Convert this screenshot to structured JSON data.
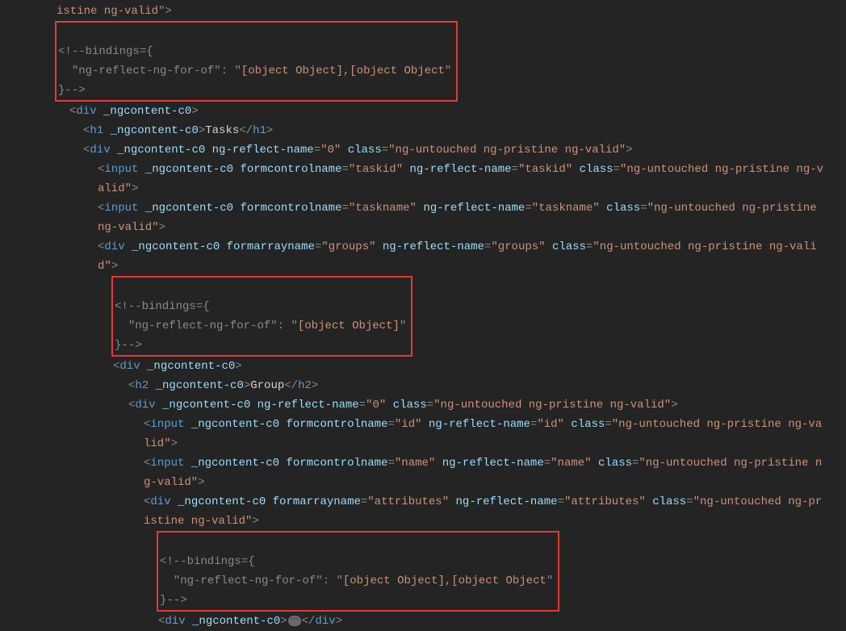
{
  "line0": {
    "text1": "istine ng-valid",
    "close": "\">"
  },
  "box1": {
    "l1": "<!--bindings={",
    "l2a": "  \"ng-reflect-ng-for-of\": \"",
    "l2b": "[object Object],[object Object",
    "l2c": "\"",
    "l3": "}-->"
  },
  "divTasks": {
    "open": "<",
    "tag": "div",
    "attr1": "_ngcontent-c0",
    "close": ">",
    "h1": {
      "open": "<",
      "tag": "h1",
      "attr": "_ngcontent-c0",
      "mid": ">",
      "text": "Tasks",
      "cOpen": "</",
      "cClose": ">"
    }
  },
  "div0": {
    "open": "<",
    "tag": "div",
    "a1": "_ngcontent-c0",
    "a2": "ng-reflect-name",
    "v2": "\"0\"",
    "a3": "class",
    "v3": "\"ng-untouched ng-pristine ng-valid\"",
    "close": ">"
  },
  "inputTaskid": {
    "open": "<",
    "tag": "input",
    "a1": "_ngcontent-c0",
    "a2": "formcontrolname",
    "v2": "\"taskid\"",
    "a3": "ng-reflect-name",
    "v3": "\"taskid\"",
    "a4": "class",
    "v4": "\"ng-untouched ng-pristine ng-valid\"",
    "close": ">"
  },
  "inputTaskname": {
    "open": "<",
    "tag": "input",
    "a1": "_ngcontent-c0",
    "a2": "formcontrolname",
    "v2": "\"taskname\"",
    "a3": "ng-reflect-name",
    "v3": "\"taskname\"",
    "a4": "class",
    "v4": "\"ng-untouched ng-pristine ng-valid\"",
    "close": ">"
  },
  "divGroups": {
    "open": "<",
    "tag": "div",
    "a1": "_ngcontent-c0",
    "a2": "formarrayname",
    "v2": "\"groups\"",
    "a3": "ng-reflect-name",
    "v3": "\"groups\"",
    "a4": "class",
    "v4": "\"ng-untouched ng-pristine ng-valid\"",
    "close": ">"
  },
  "box2": {
    "l1": "<!--bindings={",
    "l2a": "  \"ng-reflect-ng-for-of\": \"",
    "l2b": "[object Object]",
    "l2c": "\"",
    "l3": "}-->"
  },
  "divPlain": {
    "open": "<",
    "tag": "div",
    "a1": "_ngcontent-c0",
    "close": ">"
  },
  "h2Group": {
    "open": "<",
    "tag": "h2",
    "a1": "_ngcontent-c0",
    "mid": ">",
    "text": "Group",
    "cOpen": "</",
    "cClose": ">"
  },
  "div0b": {
    "open": "<",
    "tag": "div",
    "a1": "_ngcontent-c0",
    "a2": "ng-reflect-name",
    "v2": "\"0\"",
    "a3": "class",
    "v3": "\"ng-untouched ng-pristine ng-valid\"",
    "close": ">"
  },
  "inputId": {
    "open": "<",
    "tag": "input",
    "a1": "_ngcontent-c0",
    "a2": "formcontrolname",
    "v2": "\"id\"",
    "a3": "ng-reflect-name",
    "v3": "\"id\"",
    "a4": "class",
    "v4": "\"ng-untouched ng-pristine ng-valid\"",
    "close": ">"
  },
  "inputName": {
    "open": "<",
    "tag": "input",
    "a1": "_ngcontent-c0",
    "a2": "formcontrolname",
    "v2": "\"name\"",
    "a3": "ng-reflect-name",
    "v3": "\"name\"",
    "a4": "class",
    "v4": "\"ng-untouched ng-pristine ng-valid\"",
    "close": ">"
  },
  "divAttrs": {
    "open": "<",
    "tag": "div",
    "a1": "_ngcontent-c0",
    "a2": "formarrayname",
    "v2": "\"attributes\"",
    "a3": "ng-reflect-name",
    "v3": "\"attributes\"",
    "a4": "class",
    "v4": "\"ng-untouched ng-pristine ng-valid\"",
    "close": ">"
  },
  "box3": {
    "l1": "<!--bindings={",
    "l2a": "  \"ng-reflect-ng-for-of\": \"",
    "l2b": "[object Object],[object Object",
    "l2c": "\"",
    "l3": "}-->"
  },
  "divCollapsed": {
    "open": "<",
    "tag": "div",
    "a1": "_ngcontent-c0",
    "mid": ">",
    "cOpen": "</",
    "cClose": ">"
  },
  "eq": "="
}
